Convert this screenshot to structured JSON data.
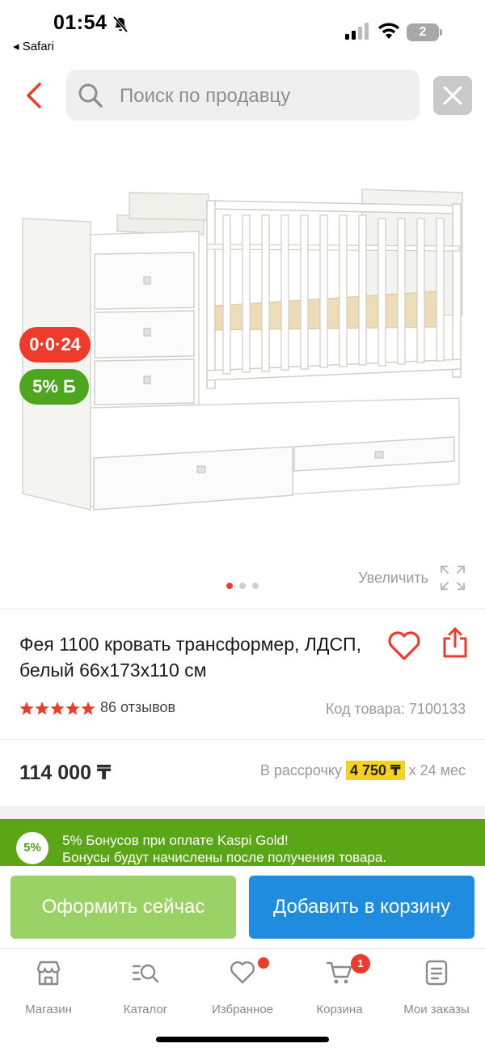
{
  "status_bar": {
    "time": "01:54",
    "back_app": "◂ Safari",
    "battery": "2"
  },
  "header": {
    "search_placeholder": "Поиск по продавцу",
    "icons": [
      "back-chevron-icon",
      "search-icon",
      "close-icon"
    ]
  },
  "gallery": {
    "promo_installment": "0·0·24",
    "promo_bonus": "5% Б",
    "zoom_label": "Увеличить",
    "image_count": 3,
    "active_image": 1
  },
  "product": {
    "title": "Фея 1100 кровать трансформер, ЛДСП, белый 66x173x110 см",
    "rating": 5,
    "reviews": "86 отзывов",
    "code": "Код товара: 7100133"
  },
  "price": {
    "value": "114 000 ₸",
    "installment_prefix": "В рассрочку",
    "installment_amount": "4 750 ₸",
    "installment_suffix": "x 24 мес"
  },
  "bonus": {
    "badge": "5%",
    "line1": "5% Бонусов при оплате Kaspi Gold!",
    "line2": "Бонусы будут начислены после получения товара."
  },
  "actions": {
    "checkout": "Оформить сейчас",
    "add_to_cart": "Добавить в корзину"
  },
  "tabbar": {
    "items": [
      {
        "label": "Магазин",
        "icon": "store-icon"
      },
      {
        "label": "Каталог",
        "icon": "catalog-search-icon"
      },
      {
        "label": "Избранное",
        "icon": "heart-icon"
      },
      {
        "label": "Корзина",
        "icon": "cart-icon",
        "badge": "1"
      },
      {
        "label": "Мои заказы",
        "icon": "orders-icon"
      }
    ]
  },
  "colors": {
    "accent_red": "#ef3b2c",
    "bonus_green": "#5aa617",
    "checkout_green": "#9bd266",
    "cart_blue": "#1f8ce0",
    "installment_yellow": "#f6d21b"
  }
}
